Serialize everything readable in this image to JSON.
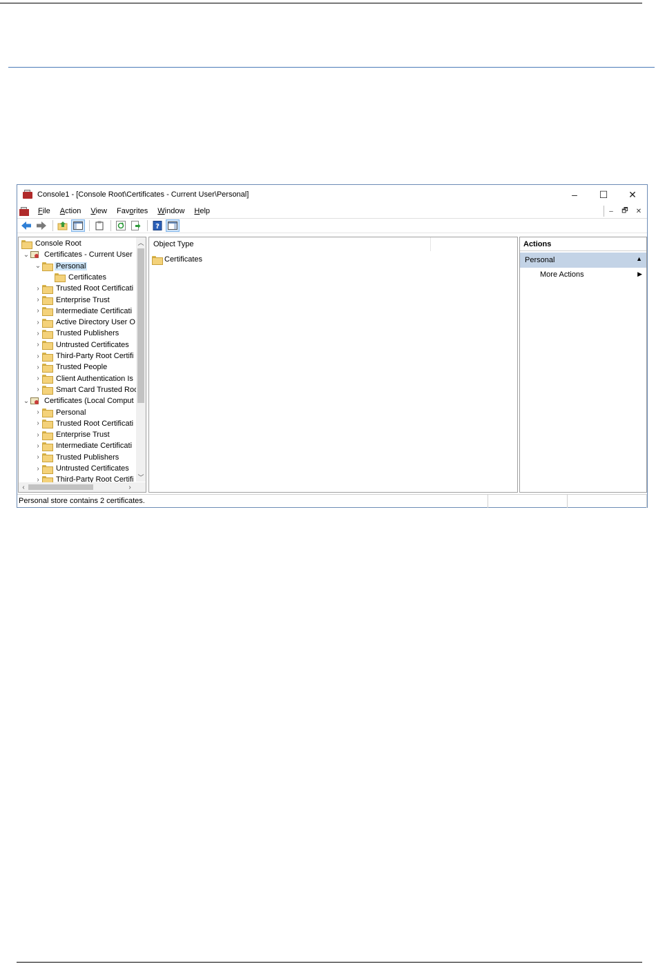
{
  "window": {
    "title": "Console1 - [Console Root\\Certificates - Current User\\Personal]",
    "controls": {
      "minimize": "–",
      "maximize": "☐",
      "close": "✕"
    }
  },
  "menubar": {
    "items": [
      {
        "label": "File",
        "hotkey": "F",
        "rest": "ile"
      },
      {
        "label": "Action",
        "hotkey": "A",
        "rest": "ction"
      },
      {
        "label": "View",
        "hotkey": "V",
        "rest": "iew"
      },
      {
        "label": "Favorites",
        "pre": "Fav",
        "hotkey": "o",
        "rest": "rites"
      },
      {
        "label": "Window",
        "hotkey": "W",
        "rest": "indow"
      },
      {
        "label": "Help",
        "hotkey": "H",
        "rest": "elp"
      }
    ],
    "mdi": {
      "minimize": "–",
      "restore": "🗗",
      "close": "✕"
    }
  },
  "toolbar": {
    "icons": [
      "back-arrow-icon",
      "forward-arrow-icon",
      "up-folder-icon",
      "show-hide-tree-icon",
      "clipboard-icon",
      "refresh-icon",
      "export-list-icon",
      "help-icon",
      "show-hide-action-pane-icon"
    ]
  },
  "tree": {
    "items": [
      {
        "label": "Console Root",
        "indent": 0,
        "icon": "folder",
        "chevron": ""
      },
      {
        "label": "Certificates - Current User",
        "indent": 1,
        "icon": "cert-store",
        "chevron": "⌄"
      },
      {
        "label": "Personal",
        "indent": 2,
        "icon": "folder",
        "chevron": "⌄",
        "selected": true
      },
      {
        "label": "Certificates",
        "indent": 3,
        "icon": "folder",
        "chevron": ""
      },
      {
        "label": "Trusted Root Certificati",
        "indent": 2,
        "icon": "folder",
        "chevron": "›"
      },
      {
        "label": "Enterprise Trust",
        "indent": 2,
        "icon": "folder",
        "chevron": "›"
      },
      {
        "label": "Intermediate Certificati",
        "indent": 2,
        "icon": "folder",
        "chevron": "›"
      },
      {
        "label": "Active Directory User O",
        "indent": 2,
        "icon": "folder",
        "chevron": "›"
      },
      {
        "label": "Trusted Publishers",
        "indent": 2,
        "icon": "folder",
        "chevron": "›"
      },
      {
        "label": "Untrusted Certificates",
        "indent": 2,
        "icon": "folder",
        "chevron": "›"
      },
      {
        "label": "Third-Party Root Certifi",
        "indent": 2,
        "icon": "folder",
        "chevron": "›"
      },
      {
        "label": "Trusted People",
        "indent": 2,
        "icon": "folder",
        "chevron": "›"
      },
      {
        "label": "Client Authentication Is",
        "indent": 2,
        "icon": "folder",
        "chevron": "›"
      },
      {
        "label": "Smart Card Trusted Roo",
        "indent": 2,
        "icon": "folder",
        "chevron": "›"
      },
      {
        "label": "Certificates (Local Comput",
        "indent": 1,
        "icon": "cert-store",
        "chevron": "⌄"
      },
      {
        "label": "Personal",
        "indent": 2,
        "icon": "folder",
        "chevron": "›"
      },
      {
        "label": "Trusted Root Certificati",
        "indent": 2,
        "icon": "folder",
        "chevron": "›"
      },
      {
        "label": "Enterprise Trust",
        "indent": 2,
        "icon": "folder",
        "chevron": "›"
      },
      {
        "label": "Intermediate Certificati",
        "indent": 2,
        "icon": "folder",
        "chevron": "›"
      },
      {
        "label": "Trusted Publishers",
        "indent": 2,
        "icon": "folder",
        "chevron": "›"
      },
      {
        "label": "Untrusted Certificates",
        "indent": 2,
        "icon": "folder",
        "chevron": "›"
      },
      {
        "label": "Third-Party Root Certifi",
        "indent": 2,
        "icon": "folder",
        "chevron": "›"
      }
    ]
  },
  "list": {
    "column_header": "Object Type",
    "rows": [
      {
        "label": "Certificates",
        "icon": "folder"
      }
    ]
  },
  "actions": {
    "header": "Actions",
    "group": "Personal",
    "items": [
      "More Actions"
    ]
  },
  "status": {
    "text": "Personal store contains 2 certificates."
  },
  "colors": {
    "selection": "#cce4f7",
    "actions_group": "#c3d3e6",
    "window_border": "#6b8bb5",
    "rule_blue": "#4a7ab8"
  }
}
